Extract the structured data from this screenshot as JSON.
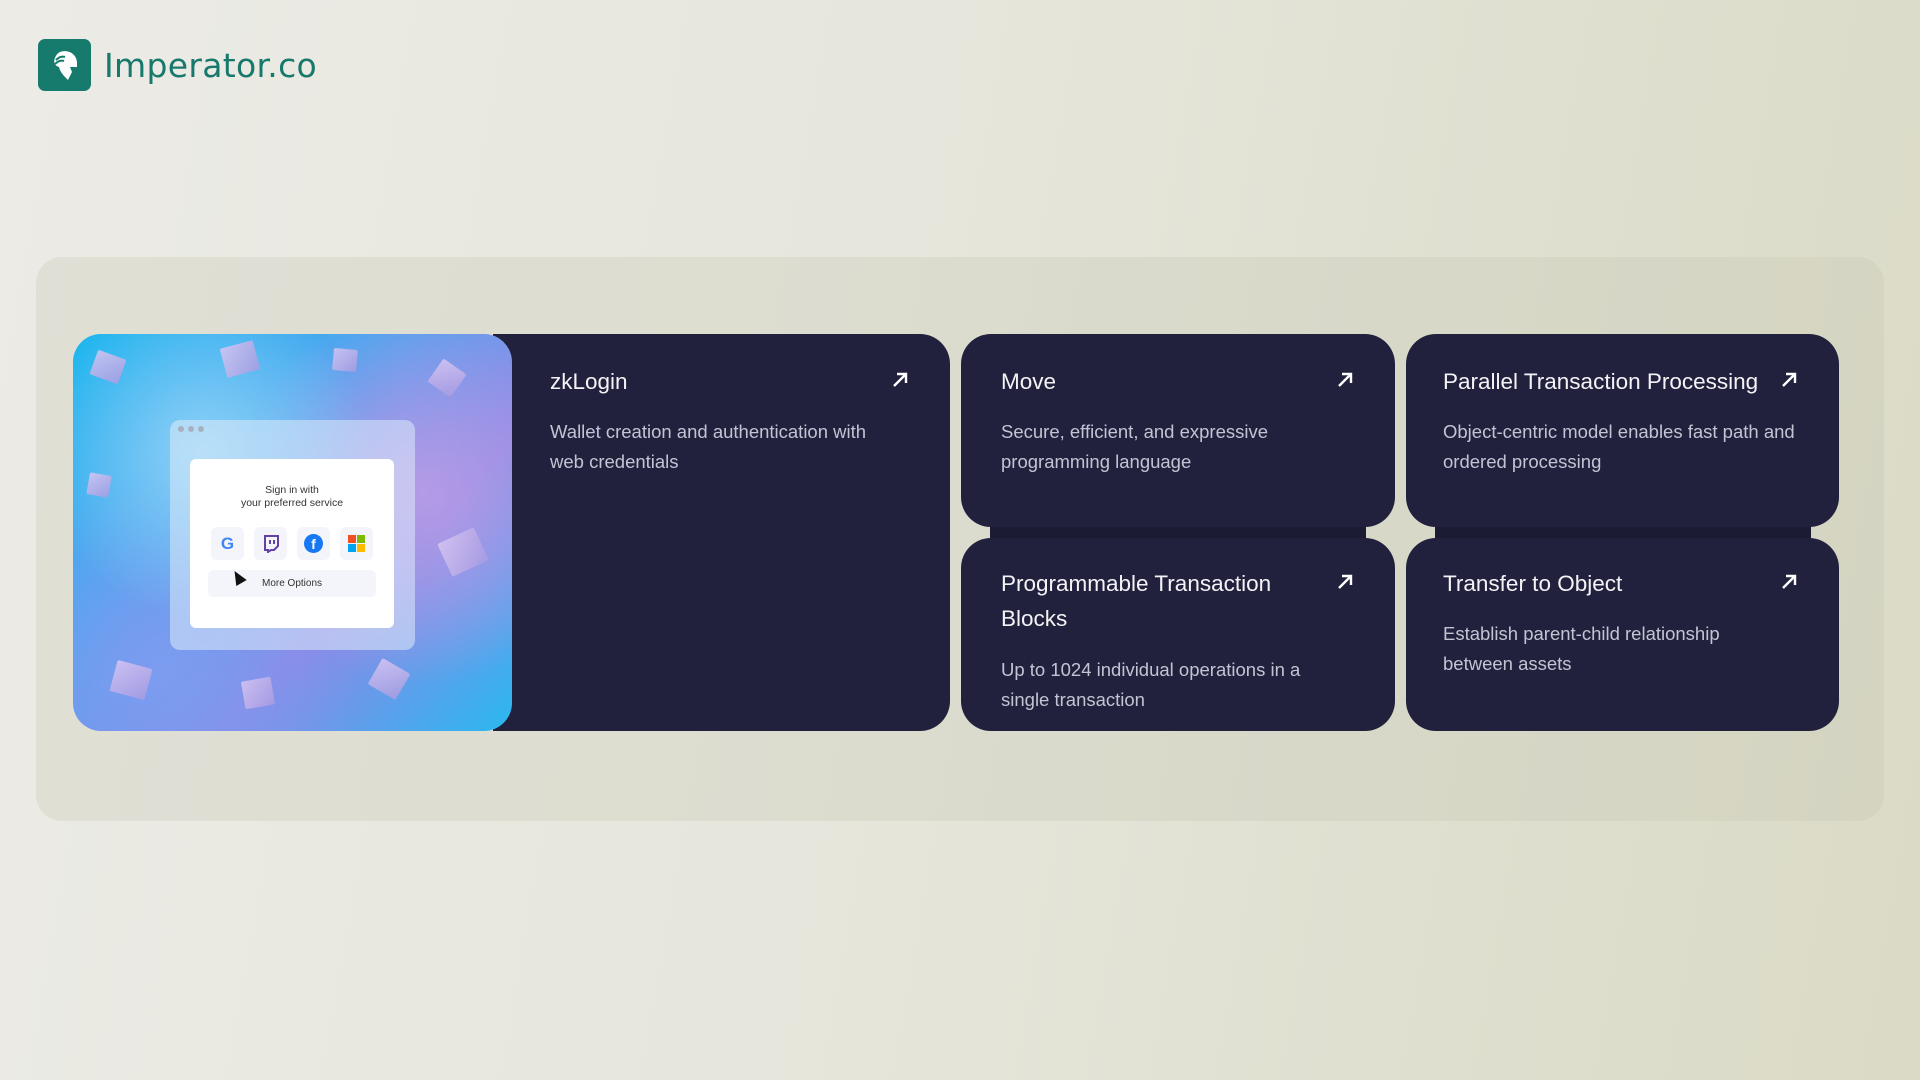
{
  "brand": {
    "name": "Imperator.co",
    "logo_icon": "spartan-helmet-icon",
    "color": "#167a6d"
  },
  "hero_image": {
    "signin_title": "Sign in with",
    "signin_subtitle": "your preferred service",
    "providers": [
      {
        "name": "Google",
        "icon": "google-icon"
      },
      {
        "name": "Twitch",
        "icon": "twitch-icon"
      },
      {
        "name": "Facebook",
        "icon": "facebook-icon"
      },
      {
        "name": "Microsoft",
        "icon": "microsoft-icon"
      }
    ],
    "more_options": "More Options"
  },
  "features": [
    {
      "title": "zkLogin",
      "description": "Wallet creation and authentication with web credentials",
      "icon": "arrow-up-right-icon"
    },
    {
      "title": "Move",
      "description": "Secure, efficient, and expressive programming language",
      "icon": "arrow-up-right-icon"
    },
    {
      "title": "Parallel Transaction Processing",
      "description": "Object-centric model enables fast path and ordered processing",
      "icon": "arrow-up-right-icon"
    },
    {
      "title": "Programmable Transaction Blocks",
      "description": "Up to 1024 individual operations in a single transaction",
      "icon": "arrow-up-right-icon"
    },
    {
      "title": "Transfer to Object",
      "description": "Establish parent-child relationship between assets",
      "icon": "arrow-up-right-icon"
    }
  ],
  "colors": {
    "card_bg": "#21213d",
    "accent": "#167a6d"
  }
}
